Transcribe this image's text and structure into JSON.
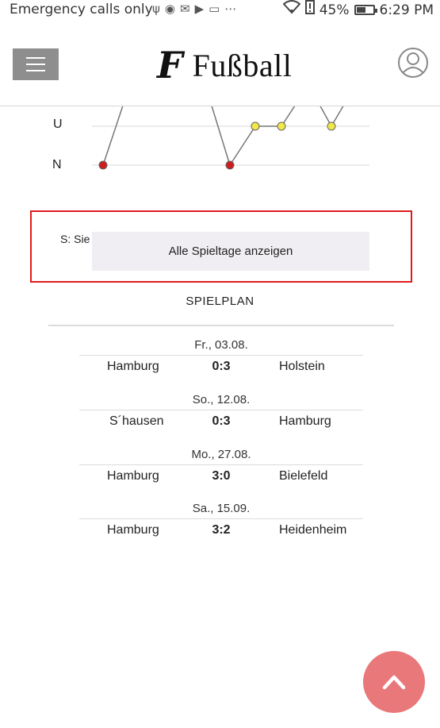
{
  "status_bar": {
    "left_text": "Emergency calls only",
    "battery": "45%",
    "time": "6:29 PM",
    "icons": [
      "usb-icon",
      "sync-icon",
      "mail-icon",
      "play-icon",
      "battery-saver-icon",
      "more-icon",
      "wifi-icon",
      "alert-icon",
      "battery-icon"
    ]
  },
  "header": {
    "logo_letter": "F",
    "logo_text": "Fußball"
  },
  "chart": {
    "labels": [
      "U",
      "N"
    ],
    "colors": {
      "loss": "#cc1e1e",
      "draw": "#f1e84a",
      "line": "#777777",
      "grid": "#d9d9d9"
    }
  },
  "legend": {
    "text": "S: Sie",
    "show_all_label": "Alle Spieltage anzeigen"
  },
  "spielplan": {
    "title": "SPIELPLAN",
    "matches": [
      {
        "date": "Fr., 03.08.",
        "home": "Hamburg",
        "score": "0:3",
        "away": "Holstein"
      },
      {
        "date": "So., 12.08.",
        "home": "S´hausen",
        "score": "0:3",
        "away": "Hamburg"
      },
      {
        "date": "Mo., 27.08.",
        "home": "Hamburg",
        "score": "3:0",
        "away": "Bielefeld"
      },
      {
        "date": "Sa., 15.09.",
        "home": "Hamburg",
        "score": "3:2",
        "away": "Heidenheim"
      }
    ]
  },
  "accent_color": "#e9787a",
  "highlight_color": "#e01b1b"
}
